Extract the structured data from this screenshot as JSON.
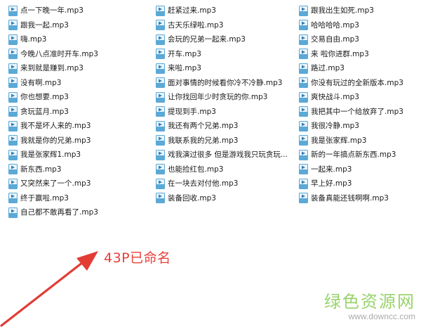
{
  "files": [
    [
      "点一下晚一年.mp3",
      "跟我一起.mp3",
      "嗨.mp3",
      "今晚八点准时开车.mp3",
      "来到就是赚到.mp3",
      "没有啊.mp3",
      "你也想要.mp3",
      "贪玩蓝月.mp3",
      "我不是坏人来的.mp3",
      "我就是你的兄弟.mp3",
      "我是张家辉1.mp3",
      "新东西.mp3",
      "又突然来了一个.mp3",
      "终于赢啦.mp3",
      "自己都不敢再看了.mp3"
    ],
    [
      "赶紧过来.mp3",
      "古天乐绿啦.mp3",
      "会玩的兄弟一起来.mp3",
      "开车.mp3",
      "来啦.mp3",
      "面对事情的时候看你冷不冷静.mp3",
      "让你找回年少时贪玩的你.mp3",
      "提现到手.mp3",
      "我还有两个兄弟.mp3",
      "我联系我的兄弟.mp3",
      "戏我演过很多 但是游戏我只玩贪玩...",
      "也能捡红包.mp3",
      "在一块去对付他.mp3",
      "装备回收.mp3"
    ],
    [
      "跟我出生如死.mp3",
      "哈哈哈哈.mp3",
      "交易自由.mp3",
      "来 啦你进群.mp3",
      "路过.mp3",
      "你没有玩过的全新版本.mp3",
      "爽快战斗.mp3",
      "我把其中一个给放弃了.mp3",
      "我很冷静.mp3",
      "我是张家辉.mp3",
      "新的一年搞点新东西.mp3",
      "一起来.mp3",
      "早上好.mp3",
      "装备真能还钱啊啊.mp3"
    ]
  ],
  "annotation": "43P已命名",
  "watermark": {
    "logo": "绿色资源网",
    "url": "www.downcc.com"
  },
  "colors": {
    "annotation": "#e8403a",
    "icon_body": "#5aa9d6",
    "icon_accent": "#2f7fb5",
    "watermark_logo": "#8ccf5a"
  },
  "icon": "mp3-file-icon"
}
